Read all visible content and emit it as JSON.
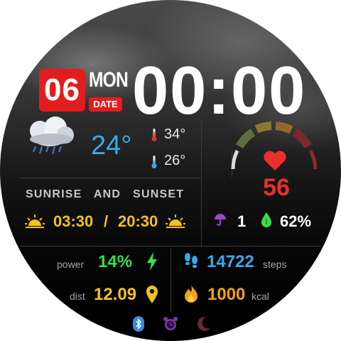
{
  "date": {
    "day": "06",
    "weekday": "MON",
    "date_label": "DATE"
  },
  "time": {
    "display": "00:00"
  },
  "weather": {
    "icon": "cloud-rain-icon",
    "temp": "24°",
    "high": "34°",
    "low": "26°"
  },
  "sun": {
    "title": "SUNRISE   AND   SUNSET",
    "sunrise": "03:30",
    "separator": "/",
    "sunset": "20:30"
  },
  "heart": {
    "value": "56",
    "color": "#e8302e"
  },
  "extras": {
    "uv": "1",
    "humidity": "62%"
  },
  "stats": {
    "power_label": "power",
    "power_value": "14%",
    "steps_value": "14722",
    "steps_label": "steps",
    "dist_label": "dist",
    "dist_value": "12.09",
    "kcal_value": "1000",
    "kcal_label": "kcal"
  },
  "status_icons": [
    "bluetooth-icon",
    "alarm-clock-icon",
    "moon-icon"
  ],
  "colors": {
    "red": "#e31d1d",
    "blue": "#35a9ee",
    "green": "#37e045",
    "yellow": "#f1c21b",
    "orange": "#f3a113",
    "purple": "#9b46c9"
  }
}
